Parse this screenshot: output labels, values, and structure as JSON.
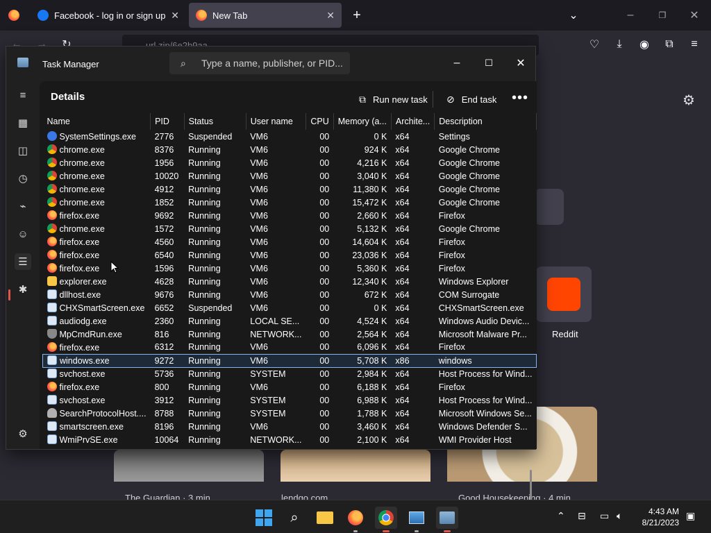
{
  "browser": {
    "tabs": [
      {
        "title": "Facebook - log in or sign up",
        "icon": "facebook-icon"
      },
      {
        "title": "New Tab",
        "icon": "firefox-icon"
      }
    ],
    "url_text": "url.zip/6e2b9aa",
    "newtab": {
      "shortcut_reddit": "Reddit",
      "stories": [
        {
          "meta": "The Guardian · 3 min"
        },
        {
          "meta": "lendgo.com"
        },
        {
          "meta": "Good Housekeeping · 4 min"
        }
      ]
    }
  },
  "taskmanager": {
    "title": "Task Manager",
    "search_placeholder": "Type a name, publisher, or PID...",
    "page_title": "Details",
    "run_new_task": "Run new task",
    "end_task": "End task",
    "more": "•••",
    "columns": [
      "Name",
      "PID",
      "Status",
      "User name",
      "CPU",
      "Memory (a...",
      "Archite...",
      "Description"
    ],
    "rows": [
      {
        "icon": "settings",
        "name": "SystemSettings.exe",
        "pid": "2776",
        "status": "Suspended",
        "user": "VM6",
        "cpu": "00",
        "mem": "0 K",
        "arch": "x64",
        "desc": "Settings"
      },
      {
        "icon": "chrome",
        "name": "chrome.exe",
        "pid": "8376",
        "status": "Running",
        "user": "VM6",
        "cpu": "00",
        "mem": "924 K",
        "arch": "x64",
        "desc": "Google Chrome"
      },
      {
        "icon": "chrome",
        "name": "chrome.exe",
        "pid": "1956",
        "status": "Running",
        "user": "VM6",
        "cpu": "00",
        "mem": "4,216 K",
        "arch": "x64",
        "desc": "Google Chrome"
      },
      {
        "icon": "chrome",
        "name": "chrome.exe",
        "pid": "10020",
        "status": "Running",
        "user": "VM6",
        "cpu": "00",
        "mem": "3,040 K",
        "arch": "x64",
        "desc": "Google Chrome"
      },
      {
        "icon": "chrome",
        "name": "chrome.exe",
        "pid": "4912",
        "status": "Running",
        "user": "VM6",
        "cpu": "00",
        "mem": "11,380 K",
        "arch": "x64",
        "desc": "Google Chrome"
      },
      {
        "icon": "chrome",
        "name": "chrome.exe",
        "pid": "1852",
        "status": "Running",
        "user": "VM6",
        "cpu": "00",
        "mem": "15,472 K",
        "arch": "x64",
        "desc": "Google Chrome"
      },
      {
        "icon": "firefox",
        "name": "firefox.exe",
        "pid": "9692",
        "status": "Running",
        "user": "VM6",
        "cpu": "00",
        "mem": "2,660 K",
        "arch": "x64",
        "desc": "Firefox"
      },
      {
        "icon": "chrome",
        "name": "chrome.exe",
        "pid": "1572",
        "status": "Running",
        "user": "VM6",
        "cpu": "00",
        "mem": "5,132 K",
        "arch": "x64",
        "desc": "Google Chrome"
      },
      {
        "icon": "firefox",
        "name": "firefox.exe",
        "pid": "4560",
        "status": "Running",
        "user": "VM6",
        "cpu": "00",
        "mem": "14,604 K",
        "arch": "x64",
        "desc": "Firefox"
      },
      {
        "icon": "firefox",
        "name": "firefox.exe",
        "pid": "6540",
        "status": "Running",
        "user": "VM6",
        "cpu": "00",
        "mem": "23,036 K",
        "arch": "x64",
        "desc": "Firefox"
      },
      {
        "icon": "firefox",
        "name": "firefox.exe",
        "pid": "1596",
        "status": "Running",
        "user": "VM6",
        "cpu": "00",
        "mem": "5,360 K",
        "arch": "x64",
        "desc": "Firefox"
      },
      {
        "icon": "explorer",
        "name": "explorer.exe",
        "pid": "4628",
        "status": "Running",
        "user": "VM6",
        "cpu": "00",
        "mem": "12,340 K",
        "arch": "x64",
        "desc": "Windows Explorer"
      },
      {
        "icon": "exe",
        "name": "dllhost.exe",
        "pid": "9676",
        "status": "Running",
        "user": "VM6",
        "cpu": "00",
        "mem": "672 K",
        "arch": "x64",
        "desc": "COM Surrogate"
      },
      {
        "icon": "exe",
        "name": "CHXSmartScreen.exe",
        "pid": "6652",
        "status": "Suspended",
        "user": "VM6",
        "cpu": "00",
        "mem": "0 K",
        "arch": "x64",
        "desc": "CHXSmartScreen.exe"
      },
      {
        "icon": "exe",
        "name": "audiodg.exe",
        "pid": "2360",
        "status": "Running",
        "user": "LOCAL SE...",
        "cpu": "00",
        "mem": "4,524 K",
        "arch": "x64",
        "desc": "Windows Audio Devic..."
      },
      {
        "icon": "shield",
        "name": "MpCmdRun.exe",
        "pid": "816",
        "status": "Running",
        "user": "NETWORK...",
        "cpu": "00",
        "mem": "2,564 K",
        "arch": "x64",
        "desc": "Microsoft Malware Pr..."
      },
      {
        "icon": "firefox",
        "name": "firefox.exe",
        "pid": "6312",
        "status": "Running",
        "user": "VM6",
        "cpu": "00",
        "mem": "6,096 K",
        "arch": "x64",
        "desc": "Firefox"
      },
      {
        "icon": "exe",
        "name": "windows.exe",
        "pid": "9272",
        "status": "Running",
        "user": "VM6",
        "cpu": "00",
        "mem": "5,708 K",
        "arch": "x86",
        "desc": "windows",
        "selected": true
      },
      {
        "icon": "exe",
        "name": "svchost.exe",
        "pid": "5736",
        "status": "Running",
        "user": "SYSTEM",
        "cpu": "00",
        "mem": "2,984 K",
        "arch": "x64",
        "desc": "Host Process for Wind..."
      },
      {
        "icon": "firefox",
        "name": "firefox.exe",
        "pid": "800",
        "status": "Running",
        "user": "VM6",
        "cpu": "00",
        "mem": "6,188 K",
        "arch": "x64",
        "desc": "Firefox"
      },
      {
        "icon": "exe",
        "name": "svchost.exe",
        "pid": "3912",
        "status": "Running",
        "user": "SYSTEM",
        "cpu": "00",
        "mem": "6,988 K",
        "arch": "x64",
        "desc": "Host Process for Wind..."
      },
      {
        "icon": "user",
        "name": "SearchProtocolHost....",
        "pid": "8788",
        "status": "Running",
        "user": "SYSTEM",
        "cpu": "00",
        "mem": "1,788 K",
        "arch": "x64",
        "desc": "Microsoft Windows Se..."
      },
      {
        "icon": "exe",
        "name": "smartscreen.exe",
        "pid": "8196",
        "status": "Running",
        "user": "VM6",
        "cpu": "00",
        "mem": "3,460 K",
        "arch": "x64",
        "desc": "Windows Defender S..."
      },
      {
        "icon": "exe",
        "name": "WmiPrvSE.exe",
        "pid": "10064",
        "status": "Running",
        "user": "NETWORK...",
        "cpu": "00",
        "mem": "2,100 K",
        "arch": "x64",
        "desc": "WMI Provider Host"
      }
    ]
  },
  "taskbar": {
    "time": "4:43 AM",
    "date": "8/21/2023"
  }
}
